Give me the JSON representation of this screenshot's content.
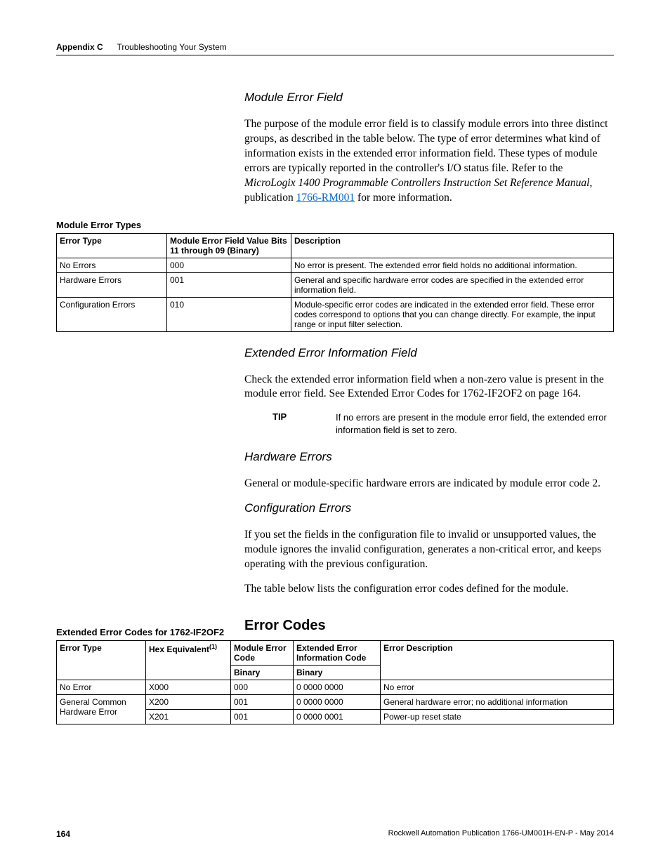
{
  "header": {
    "appendix_label": "Appendix C",
    "chapter_title": "Troubleshooting Your System"
  },
  "section1": {
    "heading": "Module Error Field",
    "para1_a": "The purpose of the module error field is to classify module errors into three distinct groups, as described in the table below. The type of error determines what kind of information exists in the extended error information field. These types of module errors are typically reported in the controller's I/O status file. Refer to the ",
    "para1_italic": "MicroLogix 1400 Programmable Controllers Instruction Set Reference Manual",
    "para1_b": ", publication ",
    "para1_link": "1766-RM001",
    "para1_c": " for more information."
  },
  "table1": {
    "title": "Module Error Types",
    "headers": {
      "c1": "Error Type",
      "c2": "Module Error Field Value Bits 11 through 09 (Binary)",
      "c3": "Description"
    },
    "rows": [
      {
        "c1": "No Errors",
        "c2": "000",
        "c3": "No error is present. The extended error field holds no additional information."
      },
      {
        "c1": "Hardware Errors",
        "c2": "001",
        "c3": "General and specific hardware error codes are specified in the extended error information field."
      },
      {
        "c1": "Configuration Errors",
        "c2": "010",
        "c3": "Module-specific error codes are indicated in the extended error field. These error codes correspond to options that you can change directly. For example, the input range or input filter selection."
      }
    ]
  },
  "section2": {
    "heading": "Extended Error Information Field",
    "para": "Check the extended error information field when a non-zero value is present in the module error field. See Extended Error Codes for 1762-IF2OF2 on page 164."
  },
  "tip": {
    "label": "TIP",
    "text": "If no errors are present in the module error field, the extended error information field is set to zero."
  },
  "section3": {
    "heading": "Hardware Errors",
    "para": "General or module-specific hardware errors are indicated by module error code 2."
  },
  "section4": {
    "heading": "Configuration Errors",
    "para1": "If you set the fields in the configuration file to invalid or unsupported values, the module ignores the invalid configuration, generates a non-critical error, and keeps operating with the previous configuration.",
    "para2": "The table below lists the configuration error codes defined for the module."
  },
  "section5": {
    "heading": "Error Codes"
  },
  "table2": {
    "title": "Extended Error Codes for 1762-IF2OF2",
    "headers": {
      "c1": "Error Type",
      "c2_a": "Hex Equivalent",
      "c2_sup": "(1)",
      "c3": "Module Error Code",
      "c4": "Extended Error Information Code",
      "c5": "Error Description",
      "sub": "Binary"
    },
    "rows": [
      {
        "c1": "No Error",
        "c2": "X000",
        "c3": "000",
        "c4": "0 0000 0000",
        "c5": "No error"
      },
      {
        "c1": "General Common Hardware Error",
        "c2": "X200",
        "c3": "001",
        "c4": "0 0000 0000",
        "c5": "General hardware error; no additional information"
      },
      {
        "c2": "X201",
        "c3": "001",
        "c4": "0 0000 0001",
        "c5": "Power-up reset state"
      }
    ]
  },
  "footer": {
    "page": "164",
    "pub": "Rockwell Automation Publication 1766-UM001H-EN-P - May 2014"
  }
}
